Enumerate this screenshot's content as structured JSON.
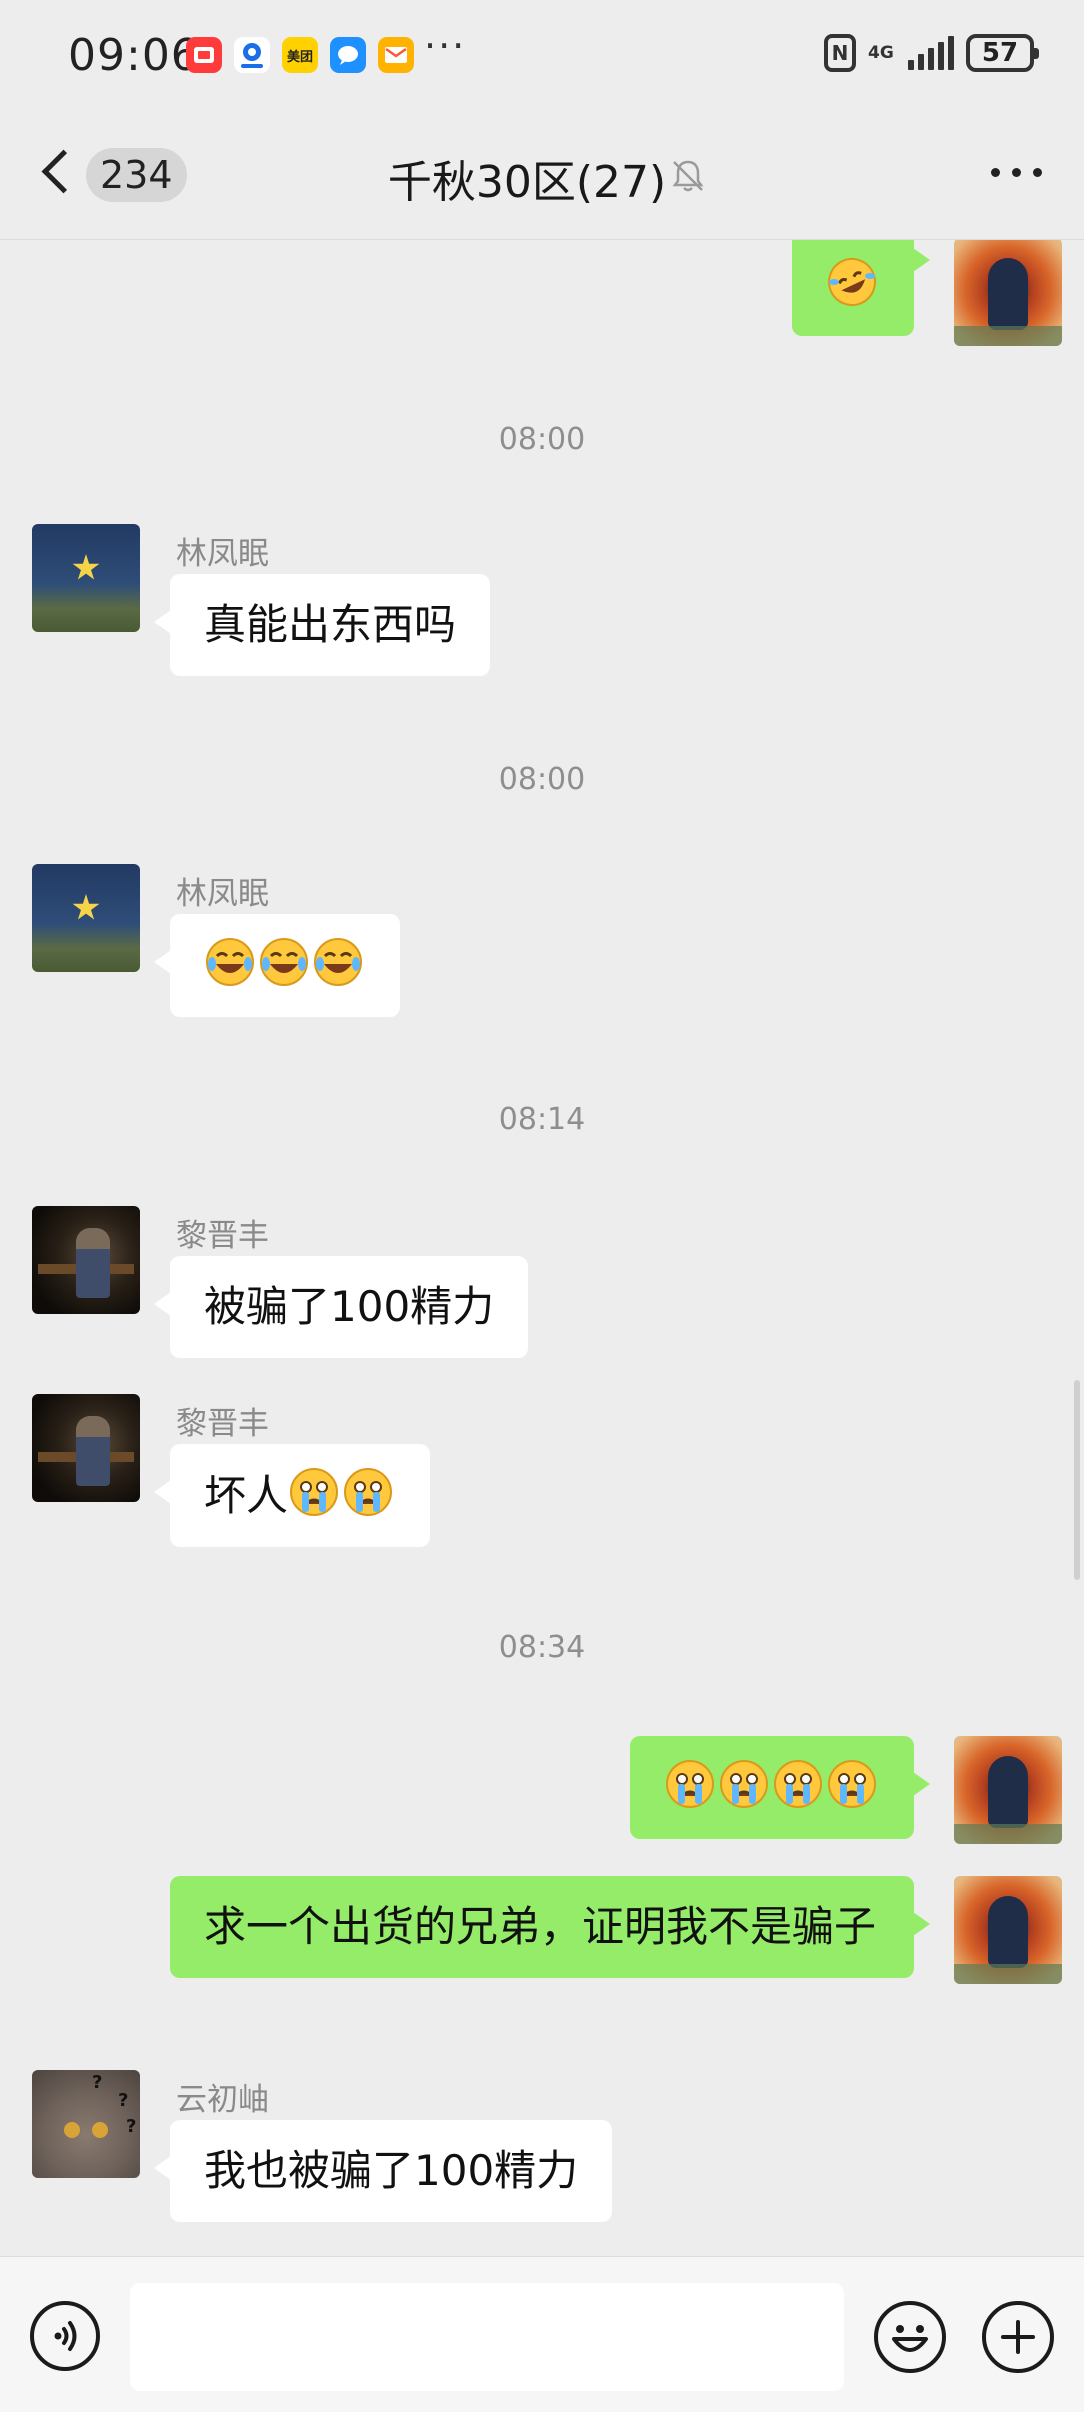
{
  "status_bar": {
    "time": "09:06",
    "app_icons": [
      "red-app-icon",
      "blue-app-icon",
      "meituan-icon",
      "chat-bubble-app-icon",
      "mail-app-icon"
    ],
    "meituan_label": "美团",
    "more": "···",
    "network": "4G",
    "battery": "57"
  },
  "header": {
    "back_count": "234",
    "title": "千秋30区(27)"
  },
  "messages": {
    "ts1": "08:00",
    "m2_name": "林凤眠",
    "m2_text": "真能出东西吗",
    "ts2": "08:00",
    "m3_name": "林凤眠",
    "ts3": "08:14",
    "m4_name": "黎晋丰",
    "m4_text": "被骗了100精力",
    "m5_name": "黎晋丰",
    "m5_text": "坏人",
    "ts4": "08:34",
    "m7_text": "求一个出货的兄弟，证明我不是骗子",
    "m8_name": "云初岫",
    "m8_text": "我也被骗了100精力"
  },
  "colors": {
    "background": "#ededed",
    "outgoing_bubble": "#95ec69",
    "incoming_bubble": "#ffffff",
    "timestamp_text": "#8e8e8e"
  },
  "input": {
    "value": "",
    "placeholder": ""
  }
}
